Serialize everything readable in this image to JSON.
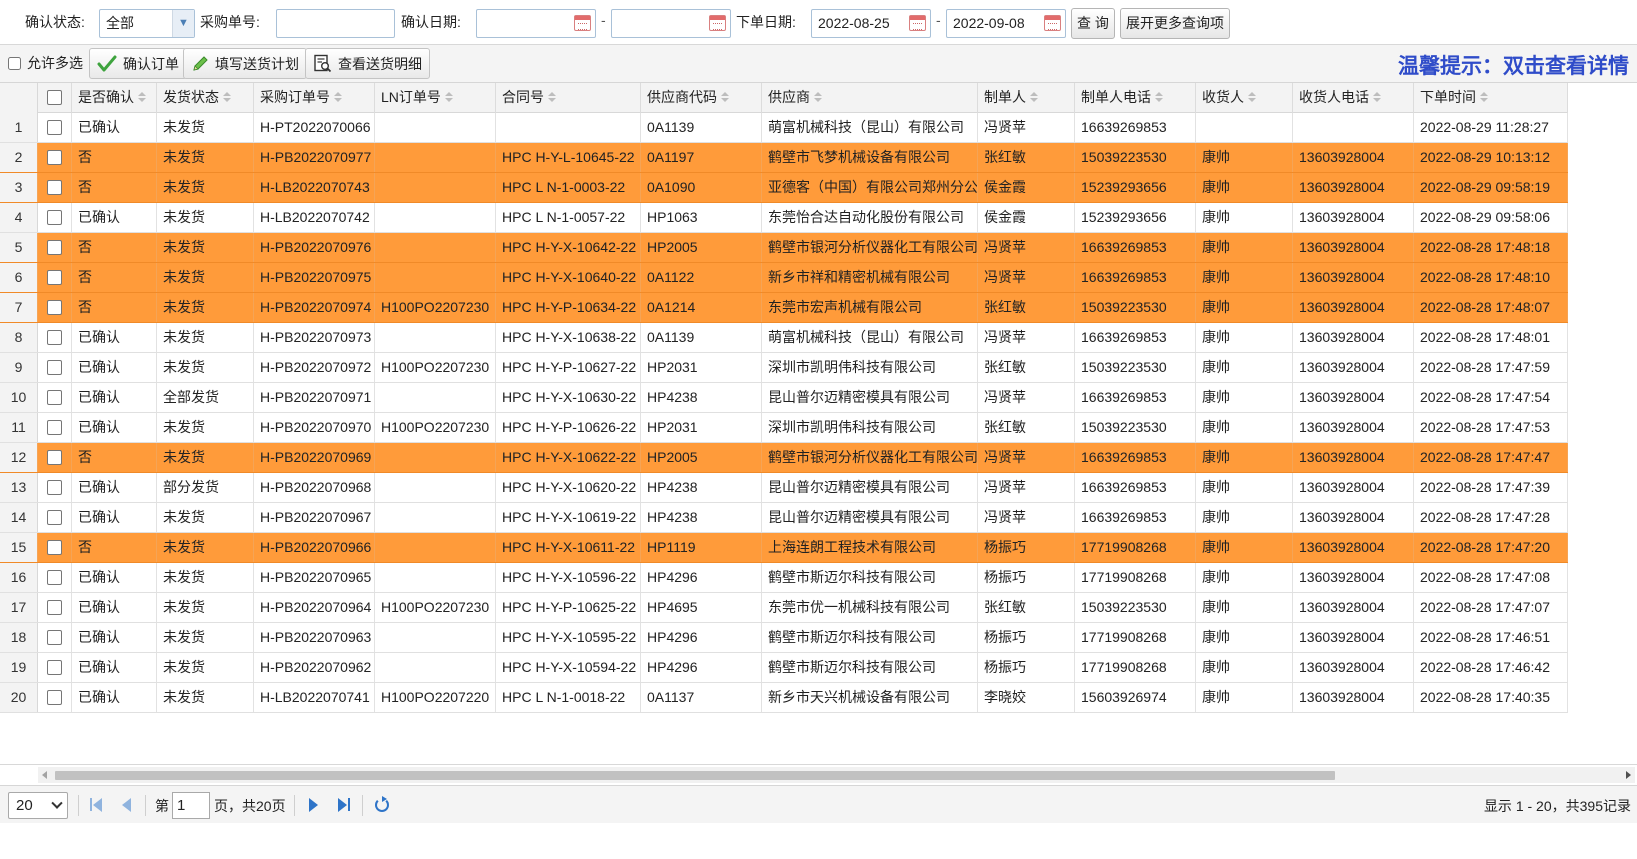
{
  "query": {
    "confirm_status_label": "确认状态:",
    "confirm_status_value": "全部",
    "po_label": "采购单号:",
    "po_value": "",
    "confirm_date_label": "确认日期:",
    "confirm_date_from": "",
    "confirm_date_to": "",
    "order_date_label": "下单日期:",
    "order_date_from": "2022-08-25",
    "order_date_to": "2022-09-08",
    "dash": "-",
    "search_label": "查 询",
    "more_label": "展开更多查询项"
  },
  "toolbar": {
    "allow_multi_label": "允许多选",
    "confirm_order_label": "确认订单",
    "fill_plan_label": "填写送货计划",
    "view_detail_label": "查看送货明细",
    "tip": "温馨提示：双击查看详情",
    "colors": {
      "confirm_icon": "#3ea33e",
      "pencil_icon": "#4caf50",
      "tip": "#2f4cc9"
    }
  },
  "grid": {
    "highlight_color": "#ff9b3a",
    "columns": [
      "是否确认",
      "发货状态",
      "采购订单号",
      "LN订单号",
      "合同号",
      "供应商代码",
      "供应商",
      "制单人",
      "制单人电话",
      "收货人",
      "收货人电话",
      "下单时间"
    ],
    "rows": [
      {
        "n": "1",
        "confirm": "已确认",
        "ship": "未发货",
        "po": "H-PT2022070066",
        "ln": "",
        "contract": "",
        "code": "0A1139",
        "supplier": "萌富机械科技（昆山）有限公司",
        "maker": "冯贤苹",
        "maker_tel": "16639269853",
        "receiver": "",
        "receiver_tel": "",
        "time": "2022-08-29 11:28:27"
      },
      {
        "n": "2",
        "confirm": "否",
        "ship": "未发货",
        "po": "H-PB2022070977",
        "ln": "",
        "contract": "HPC H-Y-L-10645-22",
        "code": "0A1197",
        "supplier": "鹤壁市飞梦机械设备有限公司",
        "maker": "张红敏",
        "maker_tel": "15039223530",
        "receiver": "康帅",
        "receiver_tel": "13603928004",
        "time": "2022-08-29 10:13:12"
      },
      {
        "n": "3",
        "confirm": "否",
        "ship": "未发货",
        "po": "H-LB2022070743",
        "ln": "",
        "contract": "HPC L N-1-0003-22",
        "code": "0A1090",
        "supplier": "亚德客（中国）有限公司郑州分公司",
        "maker": "侯金霞",
        "maker_tel": "15239293656",
        "receiver": "康帅",
        "receiver_tel": "13603928004",
        "time": "2022-08-29 09:58:19"
      },
      {
        "n": "4",
        "confirm": "已确认",
        "ship": "未发货",
        "po": "H-LB2022070742",
        "ln": "",
        "contract": "HPC L N-1-0057-22",
        "code": "HP1063",
        "supplier": "东莞怡合达自动化股份有限公司",
        "maker": "侯金霞",
        "maker_tel": "15239293656",
        "receiver": "康帅",
        "receiver_tel": "13603928004",
        "time": "2022-08-29 09:58:06"
      },
      {
        "n": "5",
        "confirm": "否",
        "ship": "未发货",
        "po": "H-PB2022070976",
        "ln": "",
        "contract": "HPC H-Y-X-10642-22",
        "code": "HP2005",
        "supplier": "鹤壁市银河分析仪器化工有限公司",
        "maker": "冯贤苹",
        "maker_tel": "16639269853",
        "receiver": "康帅",
        "receiver_tel": "13603928004",
        "time": "2022-08-28 17:48:18"
      },
      {
        "n": "6",
        "confirm": "否",
        "ship": "未发货",
        "po": "H-PB2022070975",
        "ln": "",
        "contract": "HPC H-Y-X-10640-22",
        "code": "0A1122",
        "supplier": "新乡市祥和精密机械有限公司",
        "maker": "冯贤苹",
        "maker_tel": "16639269853",
        "receiver": "康帅",
        "receiver_tel": "13603928004",
        "time": "2022-08-28 17:48:10"
      },
      {
        "n": "7",
        "confirm": "否",
        "ship": "未发货",
        "po": "H-PB2022070974",
        "ln": "H100PO2207230",
        "contract": "HPC H-Y-P-10634-22",
        "code": "0A1214",
        "supplier": "东莞市宏声机械有限公司",
        "maker": "张红敏",
        "maker_tel": "15039223530",
        "receiver": "康帅",
        "receiver_tel": "13603928004",
        "time": "2022-08-28 17:48:07"
      },
      {
        "n": "8",
        "confirm": "已确认",
        "ship": "未发货",
        "po": "H-PB2022070973",
        "ln": "",
        "contract": "HPC H-Y-X-10638-22",
        "code": "0A1139",
        "supplier": "萌富机械科技（昆山）有限公司",
        "maker": "冯贤苹",
        "maker_tel": "16639269853",
        "receiver": "康帅",
        "receiver_tel": "13603928004",
        "time": "2022-08-28 17:48:01"
      },
      {
        "n": "9",
        "confirm": "已确认",
        "ship": "未发货",
        "po": "H-PB2022070972",
        "ln": "H100PO2207230",
        "contract": "HPC H-Y-P-10627-22",
        "code": "HP2031",
        "supplier": "深圳市凯明伟科技有限公司",
        "maker": "张红敏",
        "maker_tel": "15039223530",
        "receiver": "康帅",
        "receiver_tel": "13603928004",
        "time": "2022-08-28 17:47:59"
      },
      {
        "n": "10",
        "confirm": "已确认",
        "ship": "全部发货",
        "po": "H-PB2022070971",
        "ln": "",
        "contract": "HPC H-Y-X-10630-22",
        "code": "HP4238",
        "supplier": "昆山普尔迈精密模具有限公司",
        "maker": "冯贤苹",
        "maker_tel": "16639269853",
        "receiver": "康帅",
        "receiver_tel": "13603928004",
        "time": "2022-08-28 17:47:54"
      },
      {
        "n": "11",
        "confirm": "已确认",
        "ship": "未发货",
        "po": "H-PB2022070970",
        "ln": "H100PO2207230",
        "contract": "HPC H-Y-P-10626-22",
        "code": "HP2031",
        "supplier": "深圳市凯明伟科技有限公司",
        "maker": "张红敏",
        "maker_tel": "15039223530",
        "receiver": "康帅",
        "receiver_tel": "13603928004",
        "time": "2022-08-28 17:47:53"
      },
      {
        "n": "12",
        "confirm": "否",
        "ship": "未发货",
        "po": "H-PB2022070969",
        "ln": "",
        "contract": "HPC H-Y-X-10622-22",
        "code": "HP2005",
        "supplier": "鹤壁市银河分析仪器化工有限公司",
        "maker": "冯贤苹",
        "maker_tel": "16639269853",
        "receiver": "康帅",
        "receiver_tel": "13603928004",
        "time": "2022-08-28 17:47:47"
      },
      {
        "n": "13",
        "confirm": "已确认",
        "ship": "部分发货",
        "po": "H-PB2022070968",
        "ln": "",
        "contract": "HPC H-Y-X-10620-22",
        "code": "HP4238",
        "supplier": "昆山普尔迈精密模具有限公司",
        "maker": "冯贤苹",
        "maker_tel": "16639269853",
        "receiver": "康帅",
        "receiver_tel": "13603928004",
        "time": "2022-08-28 17:47:39"
      },
      {
        "n": "14",
        "confirm": "已确认",
        "ship": "未发货",
        "po": "H-PB2022070967",
        "ln": "",
        "contract": "HPC H-Y-X-10619-22",
        "code": "HP4238",
        "supplier": "昆山普尔迈精密模具有限公司",
        "maker": "冯贤苹",
        "maker_tel": "16639269853",
        "receiver": "康帅",
        "receiver_tel": "13603928004",
        "time": "2022-08-28 17:47:28"
      },
      {
        "n": "15",
        "confirm": "否",
        "ship": "未发货",
        "po": "H-PB2022070966",
        "ln": "",
        "contract": "HPC H-Y-X-10611-22",
        "code": "HP1119",
        "supplier": "上海连朗工程技术有限公司",
        "maker": "杨振巧",
        "maker_tel": "17719908268",
        "receiver": "康帅",
        "receiver_tel": "13603928004",
        "time": "2022-08-28 17:47:20"
      },
      {
        "n": "16",
        "confirm": "已确认",
        "ship": "未发货",
        "po": "H-PB2022070965",
        "ln": "",
        "contract": "HPC H-Y-X-10596-22",
        "code": "HP4296",
        "supplier": "鹤壁市斯迈尔科技有限公司",
        "maker": "杨振巧",
        "maker_tel": "17719908268",
        "receiver": "康帅",
        "receiver_tel": "13603928004",
        "time": "2022-08-28 17:47:08"
      },
      {
        "n": "17",
        "confirm": "已确认",
        "ship": "未发货",
        "po": "H-PB2022070964",
        "ln": "H100PO2207230",
        "contract": "HPC H-Y-P-10625-22",
        "code": "HP4695",
        "supplier": "东莞市优一机械科技有限公司",
        "maker": "张红敏",
        "maker_tel": "15039223530",
        "receiver": "康帅",
        "receiver_tel": "13603928004",
        "time": "2022-08-28 17:47:07"
      },
      {
        "n": "18",
        "confirm": "已确认",
        "ship": "未发货",
        "po": "H-PB2022070963",
        "ln": "",
        "contract": "HPC H-Y-X-10595-22",
        "code": "HP4296",
        "supplier": "鹤壁市斯迈尔科技有限公司",
        "maker": "杨振巧",
        "maker_tel": "17719908268",
        "receiver": "康帅",
        "receiver_tel": "13603928004",
        "time": "2022-08-28 17:46:51"
      },
      {
        "n": "19",
        "confirm": "已确认",
        "ship": "未发货",
        "po": "H-PB2022070962",
        "ln": "",
        "contract": "HPC H-Y-X-10594-22",
        "code": "HP4296",
        "supplier": "鹤壁市斯迈尔科技有限公司",
        "maker": "杨振巧",
        "maker_tel": "17719908268",
        "receiver": "康帅",
        "receiver_tel": "13603928004",
        "time": "2022-08-28 17:46:42"
      },
      {
        "n": "20",
        "confirm": "已确认",
        "ship": "未发货",
        "po": "H-LB2022070741",
        "ln": "H100PO2207220",
        "contract": "HPC L N-1-0018-22",
        "code": "0A1137",
        "supplier": "新乡市天兴机械设备有限公司",
        "maker": "李晓姣",
        "maker_tel": "15603926974",
        "receiver": "康帅",
        "receiver_tel": "13603928004",
        "time": "2022-08-28 17:40:35"
      }
    ]
  },
  "pager": {
    "page_size": "20",
    "page_prefix": "第",
    "page_value": "1",
    "page_suffix": "页，共20页",
    "info": "显示 1 - 20，共395记录"
  }
}
